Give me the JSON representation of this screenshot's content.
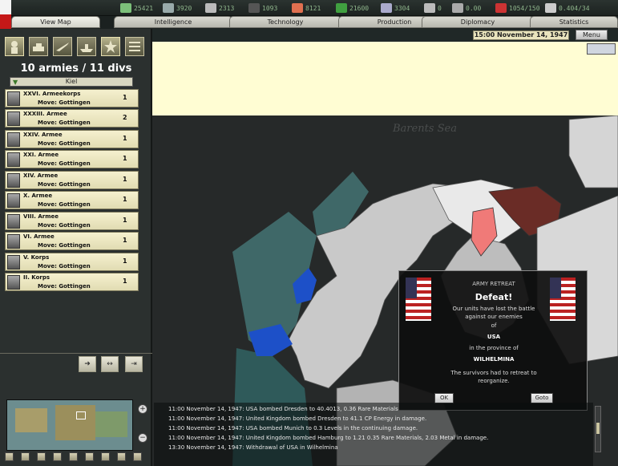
{
  "resources": [
    {
      "name": "energy-icon",
      "value": "25421",
      "color": "#7cc07a"
    },
    {
      "name": "metal-icon",
      "value": "3920",
      "color": "#9aa"
    },
    {
      "name": "rare-materials-icon",
      "value": "2313",
      "color": "#bbb"
    },
    {
      "name": "oil-icon",
      "value": "1093",
      "color": "#555"
    },
    {
      "name": "supplies-icon",
      "value": "8121",
      "color": "#e07050"
    },
    {
      "name": "money-icon",
      "value": "21600",
      "color": "#40a040"
    },
    {
      "name": "manpower-icon",
      "value": "3304",
      "color": "#aac"
    },
    {
      "name": "transport-icon",
      "value": "0",
      "color": "#bbb"
    },
    {
      "name": "dissent-icon",
      "value": "0.00",
      "color": "#aaa"
    },
    {
      "name": "industry-icon",
      "value": "1054/150",
      "color": "#c33"
    },
    {
      "name": "research-icon",
      "value": "0.404/34",
      "color": "#ccc"
    }
  ],
  "tabs": [
    {
      "label": "View Map",
      "active": true
    },
    {
      "label": "Intelligence",
      "active": false
    },
    {
      "label": "Technology",
      "active": false
    },
    {
      "label": "Production",
      "active": false
    },
    {
      "label": "Diplomacy",
      "active": false
    },
    {
      "label": "Statistics",
      "active": false
    }
  ],
  "date": "15:00 November 14, 1947",
  "menu_label": "Menu",
  "army_title": "10 armies / 11 divs",
  "location": "Kiel",
  "units": [
    {
      "name": "XXVI. Armeekorps",
      "order": "Move: Gottingen",
      "count": "1"
    },
    {
      "name": "XXXIII. Armee",
      "order": "Move: Gottingen",
      "count": "2"
    },
    {
      "name": "XXIV. Armee",
      "order": "Move: Gottingen",
      "count": "1"
    },
    {
      "name": "XXI. Armee",
      "order": "Move: Gottingen",
      "count": "1"
    },
    {
      "name": "XIV. Armee",
      "order": "Move: Gottingen",
      "count": "1"
    },
    {
      "name": "X. Armee",
      "order": "Move: Gottingen",
      "count": "1"
    },
    {
      "name": "VIII. Armee",
      "order": "Move: Gottingen",
      "count": "1"
    },
    {
      "name": "VI. Armee",
      "order": "Move: Gottingen",
      "count": "1"
    },
    {
      "name": "V. Korps",
      "order": "Move: Gottingen",
      "count": "1"
    },
    {
      "name": "II. Korps",
      "order": "Move: Gottingen",
      "count": "1"
    }
  ],
  "map_label": "Barents Sea",
  "dialog": {
    "category": "ARMY RETREAT",
    "title": "Defeat!",
    "body1": "Our units have lost the battle against our enemies",
    "of": "of",
    "nation": "USA",
    "prov_label": "in the province of",
    "province": "WILHELMINA",
    "body2": "The survivors had to retreat to reorganize.",
    "ok": "OK",
    "goto": "Goto"
  },
  "log": [
    "11:00 November 14, 1947: USA bombed Dresden to 40.4013, 0.36 Rare Materials",
    "11:00 November 14, 1947: United Kingdom bombed Dresden to 41.1 CP Energy in damage.",
    "11:00 November 14, 1947: USA bombed Munich to 0.3 Levels in the continuing damage.",
    "11:00 November 14, 1947: United Kingdom bombed Hamburg to 1.21 0.35 Rare Materials, 2.03 Metal in damage.",
    "13:30 November 14, 1947: Withdrawal of USA in Wilhelmina"
  ]
}
